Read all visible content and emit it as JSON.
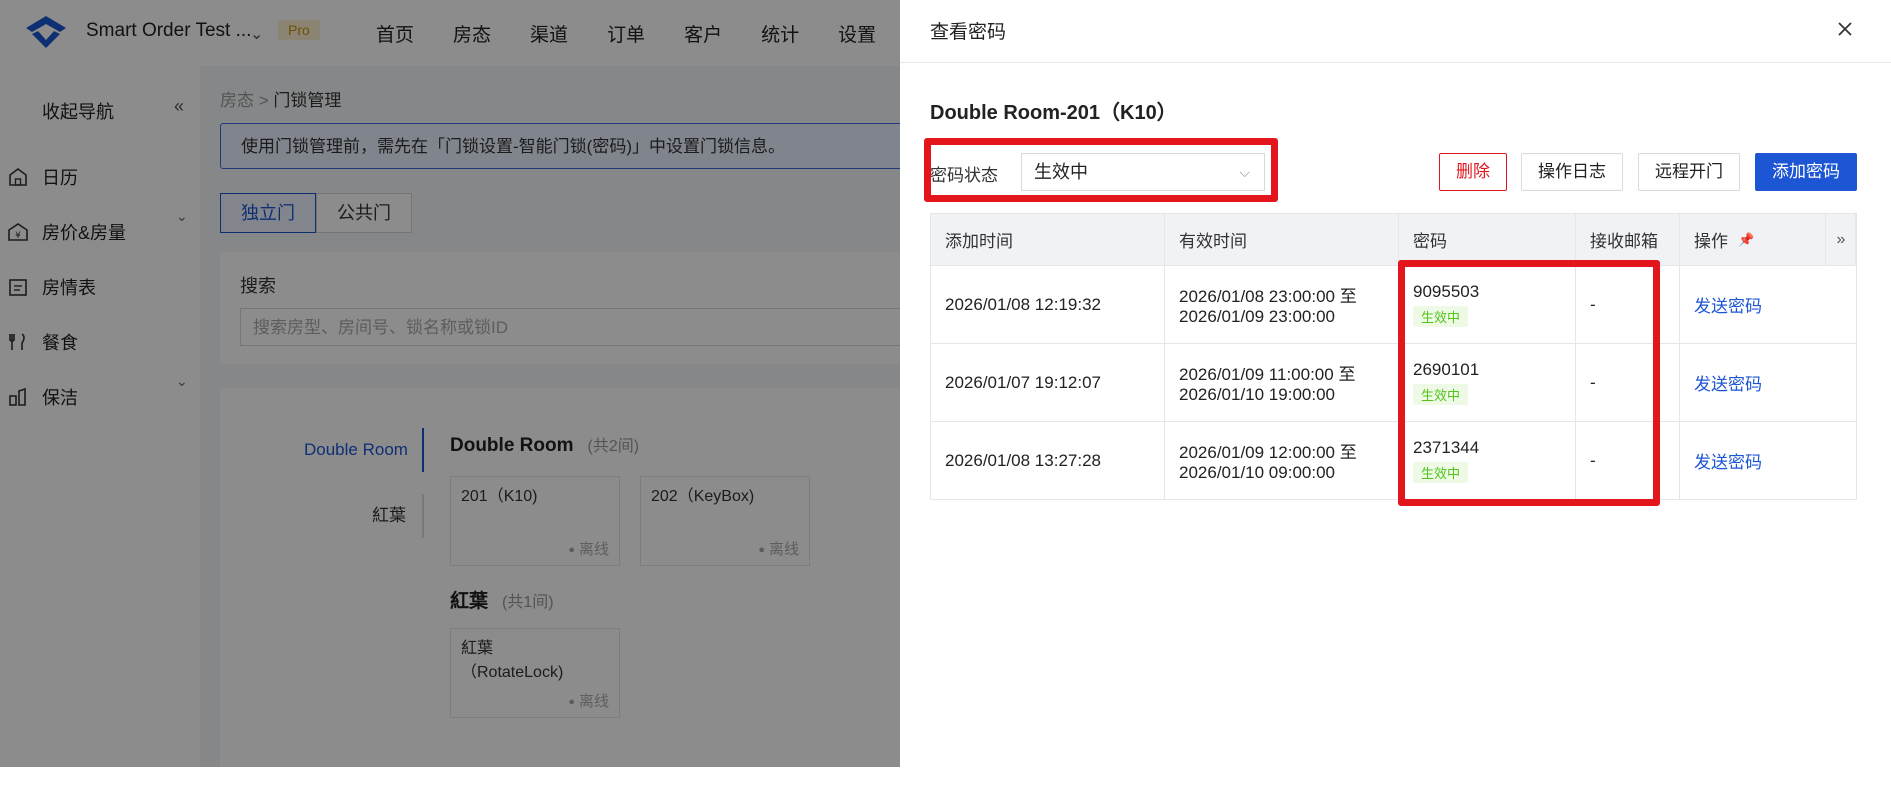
{
  "app": {
    "name": "Smart Order Test ...",
    "badge": "Pro",
    "nav": [
      "首页",
      "房态",
      "渠道",
      "订单",
      "客户",
      "统计",
      "设置"
    ]
  },
  "sidebar": {
    "collapse_label": "收起导航",
    "items": [
      {
        "label": "日历",
        "icon": "calendar-icon"
      },
      {
        "label": "房价&房量",
        "icon": "price-icon"
      },
      {
        "label": "房情表",
        "icon": "table-icon"
      },
      {
        "label": "餐食",
        "icon": "fork-knife-icon"
      },
      {
        "label": "保洁",
        "icon": "broom-icon"
      }
    ]
  },
  "main": {
    "breadcrumb": {
      "parent": "房态",
      "current": "门锁管理"
    },
    "notice": "使用门锁管理前，需先在「门锁设置-智能门锁(密码)」中设置门锁信息。",
    "tabs": [
      "独立门",
      "公共门"
    ],
    "search": {
      "label": "搜索",
      "placeholder": "搜索房型、房间号、锁名称或锁ID"
    },
    "categories": [
      "Double Room",
      "紅葉"
    ],
    "groups": [
      {
        "name": "Double Room",
        "count": "(共2间)",
        "rooms": [
          {
            "name": "201（K10)",
            "status": "离线"
          },
          {
            "name": "202（KeyBox)",
            "status": "离线"
          }
        ]
      },
      {
        "name": "紅葉",
        "count": "(共1间)",
        "rooms": [
          {
            "name": "紅葉\n（RotateLock)",
            "status": "离线"
          }
        ]
      }
    ]
  },
  "drawer": {
    "title": "查看密码",
    "room": "Double Room-201（K10）",
    "filter": {
      "label": "密码状态",
      "value": "生效中"
    },
    "buttons": {
      "delete": "删除",
      "log": "操作日志",
      "remote_open": "远程开门",
      "add": "添加密码"
    },
    "table": {
      "headers": [
        "添加时间",
        "有效时间",
        "密码",
        "接收邮箱",
        "操作"
      ],
      "rows": [
        {
          "added": "2026/01/08 12:19:32",
          "valid_from": "2026/01/08 23:00:00 至",
          "valid_to": "2026/01/09 23:00:00",
          "password": "9095503",
          "status": "生效中",
          "email": "-",
          "action": "发送密码"
        },
        {
          "added": "2026/01/07 19:12:07",
          "valid_from": "2026/01/09 11:00:00 至",
          "valid_to": "2026/01/10 19:00:00",
          "password": "2690101",
          "status": "生效中",
          "email": "-",
          "action": "发送密码"
        },
        {
          "added": "2026/01/08 13:27:28",
          "valid_from": "2026/01/09 12:00:00 至",
          "valid_to": "2026/01/10 09:00:00",
          "password": "2371344",
          "status": "生效中",
          "email": "-",
          "action": "发送密码"
        }
      ]
    }
  },
  "colors": {
    "primary": "#1d56d4",
    "danger": "#e3161d",
    "success": "#52c41a",
    "highlight": "#e3161d"
  }
}
